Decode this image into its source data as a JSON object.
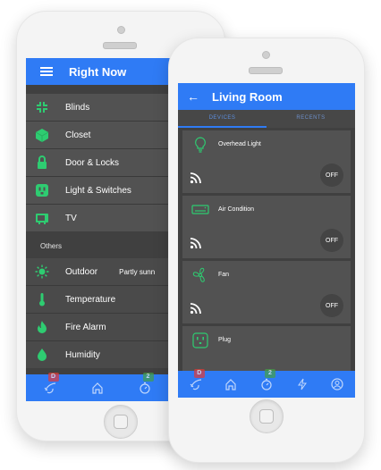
{
  "back_phone": {
    "title": "Right Now",
    "rooms": [
      {
        "label": "Blinds",
        "icon": "blinds-icon"
      },
      {
        "label": "Closet",
        "icon": "closet-icon"
      },
      {
        "label": "Door & Locks",
        "icon": "lock-icon"
      },
      {
        "label": "Light & Switches",
        "icon": "outlet-icon"
      },
      {
        "label": "TV",
        "icon": "tv-icon"
      }
    ],
    "section_label": "Others",
    "sensors": [
      {
        "label": "Outdoor",
        "value": "Partly sunn",
        "icon": "sun-icon"
      },
      {
        "label": "Temperature",
        "value": "",
        "icon": "thermometer-icon"
      },
      {
        "label": "Fire Alarm",
        "value": "",
        "icon": "fire-icon"
      },
      {
        "label": "Humidity",
        "value": "",
        "icon": "drop-icon"
      }
    ],
    "badges": {
      "alerts": "D",
      "timers": "2"
    }
  },
  "front_phone": {
    "title": "Living Room",
    "tabs": [
      "DEVICES",
      "RECENTS"
    ],
    "devices": [
      {
        "name": "Overhead Light",
        "state": "OFF",
        "icon": "bulb-icon"
      },
      {
        "name": "Air Condition",
        "state": "OFF",
        "icon": "air-conditioner-icon"
      },
      {
        "name": "Fan",
        "state": "OFF",
        "icon": "fan-icon"
      },
      {
        "name": "Plug",
        "state": "",
        "icon": "plug-icon"
      }
    ],
    "badges": {
      "alerts": "D",
      "timers": "2"
    }
  },
  "colors": {
    "accent": "#2f7bf5",
    "icon_green": "#2ecc71",
    "alert_red": "#e53935",
    "badge_green": "#43a047"
  }
}
